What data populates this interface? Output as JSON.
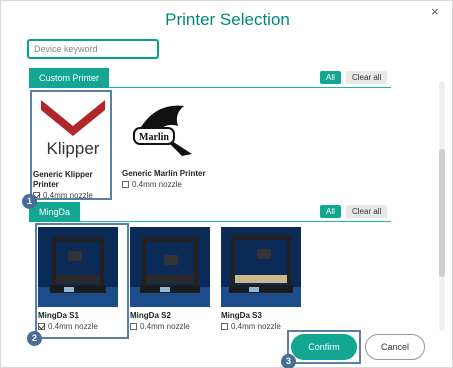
{
  "dialog": {
    "title": "Printer Selection",
    "close_glyph": "×"
  },
  "search": {
    "placeholder": "Device keyword"
  },
  "sections": [
    {
      "tab_label": "Custom Printer",
      "all_label": "All",
      "clear_label": "Clear all",
      "printers": [
        {
          "name": "Generic Klipper\nPrinter",
          "nozzle": "0.4mm nozzle",
          "checked": true,
          "logo_text": "Klipper"
        },
        {
          "name": "Generic Marlin Printer",
          "nozzle": "0.4mm nozzle",
          "checked": false,
          "logo_text": "Marlin"
        }
      ]
    },
    {
      "tab_label": "MingDa",
      "all_label": "All",
      "clear_label": "Clear all",
      "printers": [
        {
          "name": "MingDa S1",
          "nozzle": "0.4mm nozzle",
          "checked": true
        },
        {
          "name": "MingDa S2",
          "nozzle": "0.4mm nozzle",
          "checked": false
        },
        {
          "name": "MingDa S3",
          "nozzle": "0.4mm nozzle",
          "checked": false
        }
      ]
    }
  ],
  "badges": [
    "1",
    "2",
    "3"
  ],
  "footer": {
    "confirm_label": "Confirm",
    "cancel_label": "Cancel"
  },
  "colors": {
    "accent": "#12a693",
    "highlight": "#4a6d96"
  }
}
